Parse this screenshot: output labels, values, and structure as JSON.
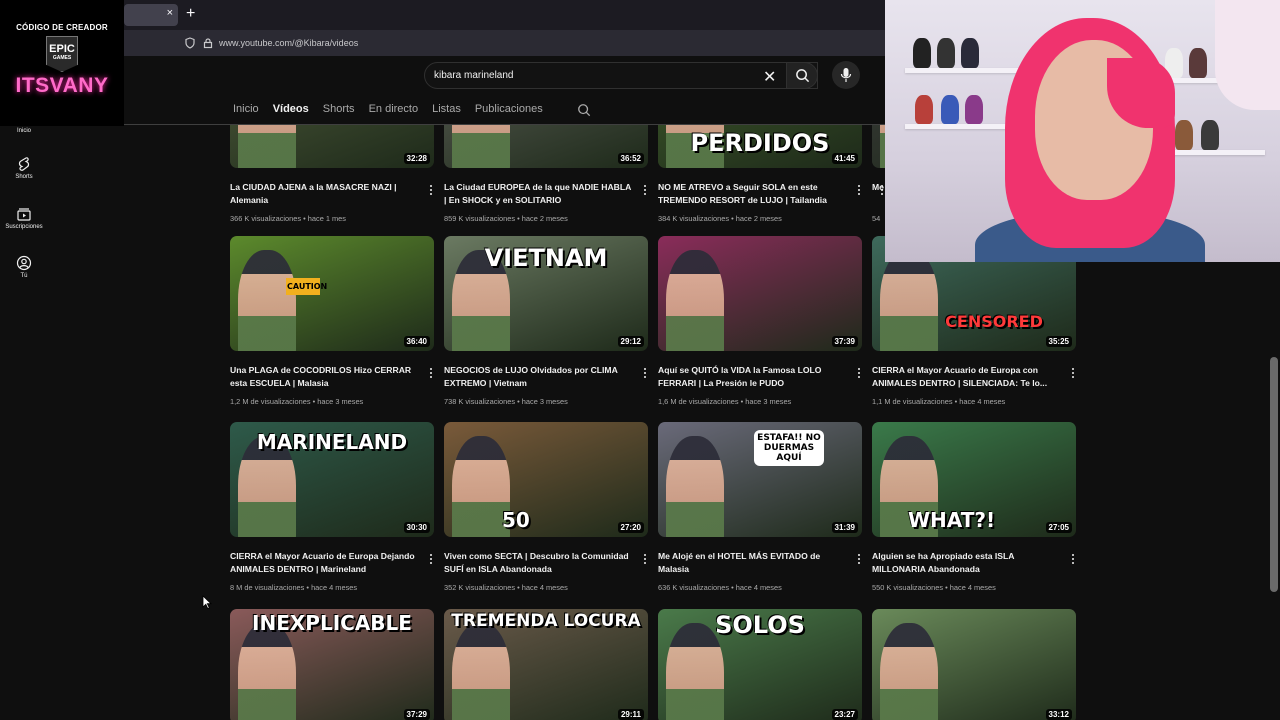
{
  "browser": {
    "tab_title": "",
    "new_tab_symbol": "+",
    "close_symbol": "×",
    "url": "www.youtube.com/@Kibara/videos"
  },
  "overlay": {
    "creator_label": "CÓDIGO DE CREADOR",
    "logo_text_top": "EPIC",
    "logo_text_bottom": "GAMES",
    "streamer_name": "ITSVANY"
  },
  "sidebar": {
    "items": [
      {
        "label": "Inicio",
        "icon": "home-icon"
      },
      {
        "label": "Shorts",
        "icon": "shorts-icon"
      },
      {
        "label": "Suscripciones",
        "icon": "subscriptions-icon"
      },
      {
        "label": "Tú",
        "icon": "you-icon"
      }
    ]
  },
  "search": {
    "value": "kibara marineland",
    "clear_symbol": "✕"
  },
  "channel_tabs": [
    {
      "label": "Inicio",
      "active": false
    },
    {
      "label": "Vídeos",
      "active": true
    },
    {
      "label": "Shorts",
      "active": false
    },
    {
      "label": "En directo",
      "active": false
    },
    {
      "label": "Listas",
      "active": false
    },
    {
      "label": "Publicaciones",
      "active": false
    }
  ],
  "videos": [
    {
      "thumb_text": "",
      "duration": "32:28",
      "title": "La CIUDAD AJENA a la MASACRE NAZI | Alemania",
      "views": "366 K visualizaciones",
      "age": "hace 1 mes",
      "color": "#4d5a3a"
    },
    {
      "thumb_text": "",
      "duration": "36:52",
      "title": "La Ciudad EUROPEA de la que NADIE HABLA | En SHOCK y en SOLITARIO",
      "views": "859 K visualizaciones",
      "age": "hace 2 meses",
      "color": "#5a5e55"
    },
    {
      "thumb_text": "PERDIDOS",
      "duration": "41:45",
      "title": "NO ME ATREVO a Seguir SOLA en este TREMENDO RESORT de LUJO | Tailandia",
      "views": "384 K visualizaciones",
      "age": "hace 2 meses",
      "color": "#3e5a2a"
    },
    {
      "thumb_text": "",
      "duration": "",
      "title": "Me en",
      "views": "54",
      "age": "",
      "color": "#3a3a3a"
    },
    {
      "thumb_text": "CAUTION",
      "duration": "36:40",
      "title": "Una PLAGA de COCODRILOS Hizo CERRAR esta ESCUELA | Malasia",
      "views": "1,2 M de visualizaciones",
      "age": "hace 3 meses",
      "color": "#5c8a2c"
    },
    {
      "thumb_text": "VIETNAM",
      "duration": "29:12",
      "title": "NEGOCIOS de LUJO Olvidados por CLIMA EXTREMO | Vietnam",
      "views": "738 K visualizaciones",
      "age": "hace 3 meses",
      "color": "#6b7a62"
    },
    {
      "thumb_text": "",
      "duration": "37:39",
      "title": "Aquí se QUITÓ la VIDA la Famosa LOLO FERRARI | La Presión le PUDO",
      "views": "1,6 M de visualizaciones",
      "age": "hace 3 meses",
      "color": "#8a2c5a"
    },
    {
      "thumb_text": "CENSORED",
      "duration": "35:25",
      "title": "CIERRA el Mayor Acuario de Europa con ANIMALES DENTRO | SILENCIADA: Te lo...",
      "views": "1,1 M de visualizaciones",
      "age": "hace 4 meses",
      "color": "#3e6a5c"
    },
    {
      "thumb_text": "MARINELAND",
      "duration": "30:30",
      "title": "CIERRA el Mayor Acuario de Europa Dejando ANIMALES DENTRO | Marineland",
      "views": "8 M de visualizaciones",
      "age": "hace 4 meses",
      "color": "#2e5a4a"
    },
    {
      "thumb_text": "50",
      "duration": "27:20",
      "title": "Viven como SECTA | Descubro la Comunidad SUFÍ en ISLA Abandonada",
      "views": "352 K visualizaciones",
      "age": "hace 4 meses",
      "color": "#7a5a3a"
    },
    {
      "thumb_text": "ESTAFA!! NO DUERMAS AQUÍ",
      "duration": "31:39",
      "title": "Me Alojé en el HOTEL MÁS EVITADO de Malasia",
      "views": "636 K visualizaciones",
      "age": "hace 4 meses",
      "color": "#6a6a7a"
    },
    {
      "thumb_text": "WHAT?!",
      "duration": "27:05",
      "title": "Alguien se ha Apropiado esta ISLA MILLONARIA Abandonada",
      "views": "550 K visualizaciones",
      "age": "hace 4 meses",
      "color": "#3a7a4a"
    },
    {
      "thumb_text": "INEXPLICABLE",
      "duration": "37:29",
      "title": "",
      "views": "",
      "age": "",
      "color": "#8a5a5a"
    },
    {
      "thumb_text": "TREMENDA LOCURA",
      "duration": "29:11",
      "title": "",
      "views": "",
      "age": "",
      "color": "#6a5a4a"
    },
    {
      "thumb_text": "SOLOS",
      "duration": "23:27",
      "title": "",
      "views": "",
      "age": "",
      "color": "#4a7a4a"
    },
    {
      "thumb_text": "",
      "duration": "33:12",
      "title": "",
      "views": "",
      "age": "",
      "color": "#6a8a5a"
    }
  ],
  "meta_separator": " • "
}
